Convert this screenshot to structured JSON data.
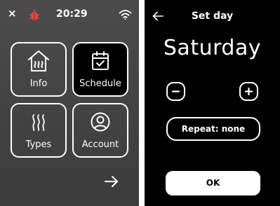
{
  "left_screen": {
    "status_bar": {
      "close_symbol": "×",
      "time": "20:29",
      "icons": [
        "close-icon",
        "bug-icon",
        "wifi-icon"
      ],
      "bug_color": "#e8473e"
    },
    "tiles": [
      {
        "label": "Info",
        "icon": "house-heating-icon",
        "selected": false
      },
      {
        "label": "Schedule",
        "icon": "calendar-check-icon",
        "selected": true
      },
      {
        "label": "Types",
        "icon": "heat-waves-icon",
        "selected": false
      },
      {
        "label": "Account",
        "icon": "user-icon",
        "selected": false
      }
    ],
    "next_icon": "arrow-right-icon"
  },
  "right_screen": {
    "title": "Set day",
    "back_icon": "arrow-left-icon",
    "day": "Saturday",
    "minus_icon": "minus-icon",
    "plus_icon": "plus-icon",
    "repeat_label": "Repeat: none",
    "ok_label": "OK"
  },
  "colors": {
    "left_background": "#444444",
    "right_background": "#000000",
    "foreground": "#ffffff",
    "selected_tile": "#000000"
  }
}
